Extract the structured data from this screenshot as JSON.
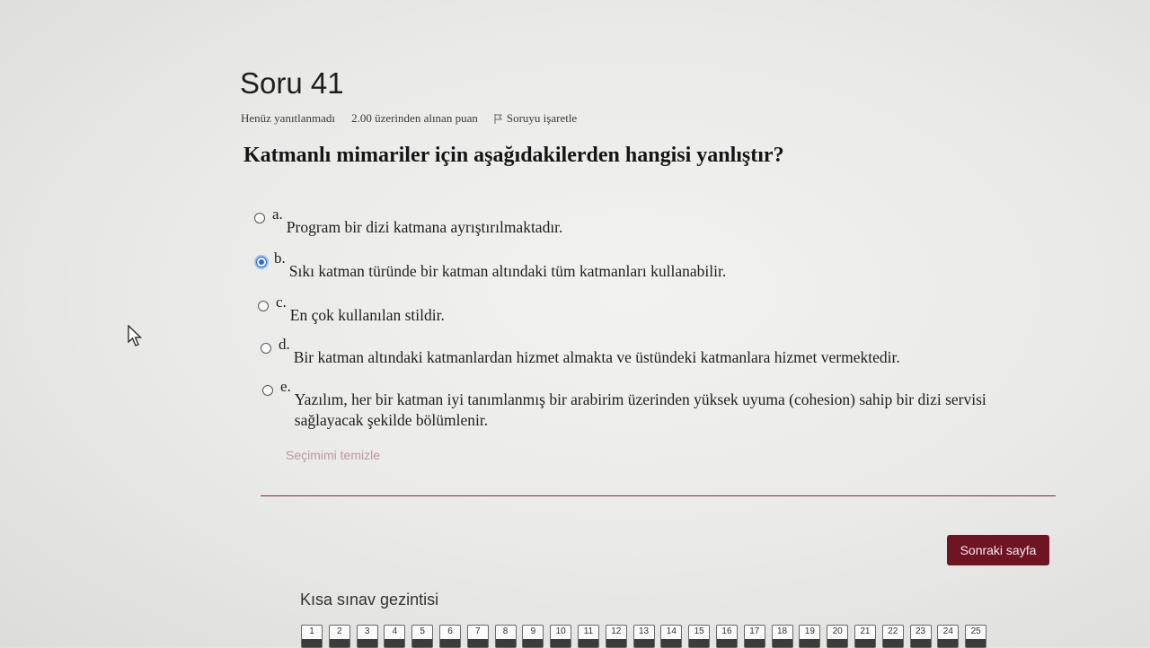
{
  "question": {
    "title": "Soru 41",
    "status": "Henüz yanıtlanmadı",
    "points": "2.00 üzerinden alınan puan",
    "flag_label": "Soruyu işaretle",
    "text": "Katmanlı mimariler için aşağıdakilerden hangisi yanlıştır?",
    "options": [
      {
        "letter": "a.",
        "text": "Program bir dizi katmana ayrıştırılmaktadır.",
        "selected": false
      },
      {
        "letter": "b.",
        "text": "Sıkı katman türünde bir katman altındaki tüm katmanları kullanabilir.",
        "selected": true
      },
      {
        "letter": "c.",
        "text": "En çok kullanılan stildir.",
        "selected": false
      },
      {
        "letter": "d.",
        "text": "Bir katman altındaki katmanlardan hizmet almakta ve üstündeki katmanlara hizmet vermektedir.",
        "selected": false
      },
      {
        "letter": "e.",
        "text": "Yazılım, her bir katman iyi tanımlanmış bir arabirim üzerinden yüksek uyuma (cohesion) sahip bir dizi servisi sağlayacak şekilde bölümlenir.",
        "selected": false
      }
    ],
    "clear_label": "Seçimimi temizle"
  },
  "next_button": "Sonraki sayfa",
  "quiz_nav": {
    "title": "Kısa sınav gezintisi",
    "buttons": [
      "1",
      "2",
      "3",
      "4",
      "5",
      "6",
      "7",
      "8",
      "9",
      "10",
      "11",
      "12",
      "13",
      "14",
      "15",
      "16",
      "17",
      "18",
      "19",
      "20",
      "21",
      "22",
      "23",
      "24",
      "25"
    ]
  },
  "colors": {
    "accent": "#6e1423",
    "radio_selected": "#2b6bd6"
  }
}
